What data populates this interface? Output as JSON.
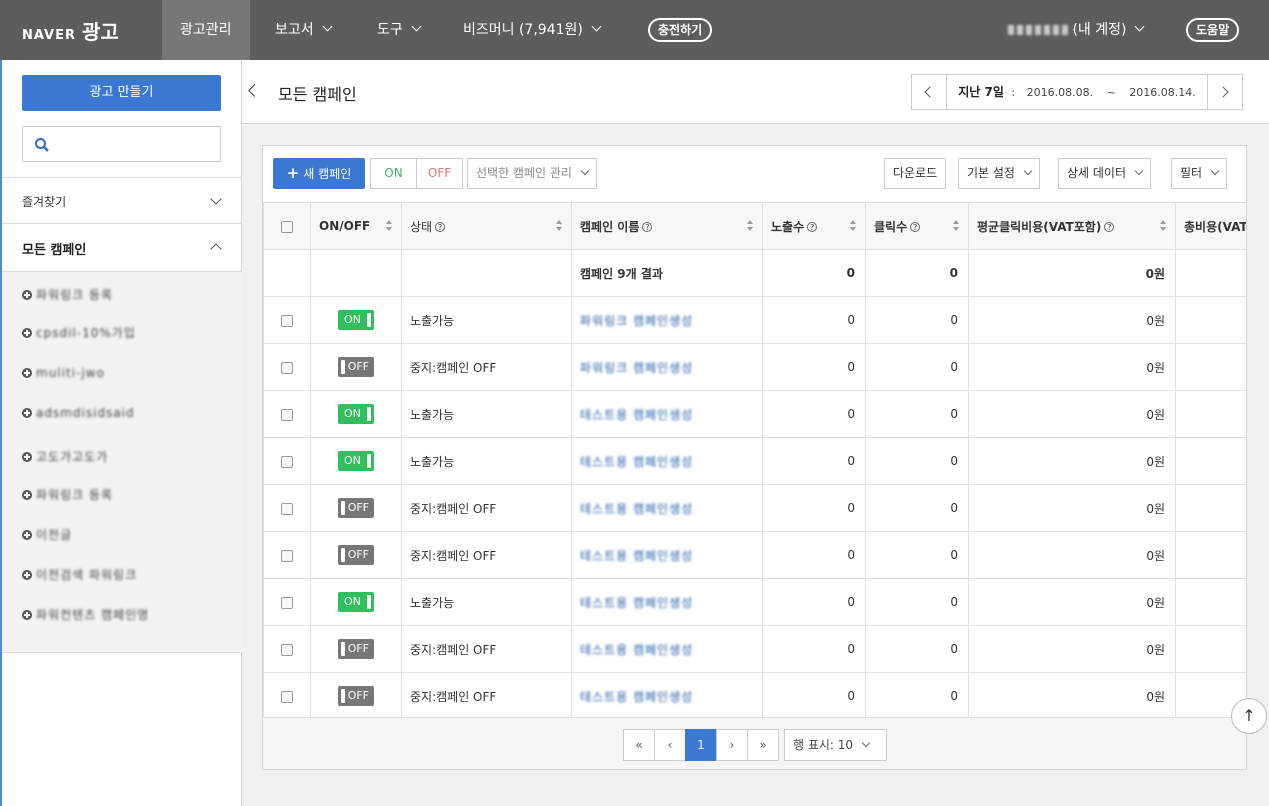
{
  "brand": {
    "naver": "NAVER",
    "ad": "광고"
  },
  "topnav": {
    "items": [
      {
        "label": "광고관리"
      },
      {
        "label": "보고서"
      },
      {
        "label": "도구"
      },
      {
        "label": "비즈머니 (7,941원)"
      }
    ],
    "charge_button": "충전하기",
    "account": "(내 계정)",
    "help": "도움말"
  },
  "sidebar": {
    "create_button": "광고 만들기",
    "favorites": "즐겨찾기",
    "all_campaigns": "모든 캠페인",
    "campaigns": [
      "파워링크 등록",
      "cpsdil-10%가입",
      "muliti-jwo",
      "adsmdisidsaid",
      "고도가고도가",
      "파워링크 등록",
      "이전글",
      "이전검색 파워링크",
      "파워컨텐츠 캠페인명"
    ]
  },
  "header": {
    "title": "모든 캠페인",
    "date_label": "지난 7일",
    "date_sep": ":",
    "date_start": "2016.08.08.",
    "date_tilde": "~",
    "date_end": "2016.08.14."
  },
  "toolbar": {
    "new_campaign": "새 캠페인",
    "on": "ON",
    "off": "OFF",
    "manage_selected": "선택한 캠페인 관리",
    "download": "다운로드",
    "default_settings": "기본 설정",
    "detail_data": "상세 데이터",
    "filter": "필터"
  },
  "table": {
    "headers": [
      "ON/OFF",
      "상태",
      "캠페인 이름",
      "노출수",
      "클릭수",
      "평균클릭비용(VAT포함)",
      "총비용(VAT포"
    ],
    "summary": {
      "label": "캠페인 9개 결과",
      "impressions": "0",
      "clicks": "0",
      "avg_cpc": "0원"
    },
    "rows": [
      {
        "toggle": "ON",
        "status": "노출가능",
        "name": "파워링크 캠페인생성",
        "impressions": "0",
        "clicks": "0",
        "avg_cpc": "0원"
      },
      {
        "toggle": "OFF",
        "status": "중지:캠페인 OFF",
        "name": "파워링크 캠페인생성",
        "impressions": "0",
        "clicks": "0",
        "avg_cpc": "0원"
      },
      {
        "toggle": "ON",
        "status": "노출가능",
        "name": "테스트용 캠페인생성",
        "impressions": "0",
        "clicks": "0",
        "avg_cpc": "0원"
      },
      {
        "toggle": "ON",
        "status": "노출가능",
        "name": "테스트용 캠페인생성",
        "impressions": "0",
        "clicks": "0",
        "avg_cpc": "0원"
      },
      {
        "toggle": "OFF",
        "status": "중지:캠페인 OFF",
        "name": "테스트용 캠페인생성",
        "impressions": "0",
        "clicks": "0",
        "avg_cpc": "0원"
      },
      {
        "toggle": "OFF",
        "status": "중지:캠페인 OFF",
        "name": "테스트용 캠페인생성",
        "impressions": "0",
        "clicks": "0",
        "avg_cpc": "0원"
      },
      {
        "toggle": "ON",
        "status": "노출가능",
        "name": "테스트용 캠페인생성",
        "impressions": "0",
        "clicks": "0",
        "avg_cpc": "0원"
      },
      {
        "toggle": "OFF",
        "status": "중지:캠페인 OFF",
        "name": "테스트용 캠페인생성",
        "impressions": "0",
        "clicks": "0",
        "avg_cpc": "0원"
      },
      {
        "toggle": "OFF",
        "status": "중지:캠페인 OFF",
        "name": "테스트용 캠페인생성",
        "impressions": "0",
        "clicks": "0",
        "avg_cpc": "0원"
      }
    ]
  },
  "pagination": {
    "first": "«",
    "prev": "‹",
    "current": "1",
    "next": "›",
    "last": "»",
    "rows_label": "행 표시: 10"
  },
  "scroll_top": "↑",
  "colors": {
    "accent": "#3a78d4",
    "on": "#2fbf5c",
    "off": "#777777",
    "topnav": "#5d5d5d"
  }
}
